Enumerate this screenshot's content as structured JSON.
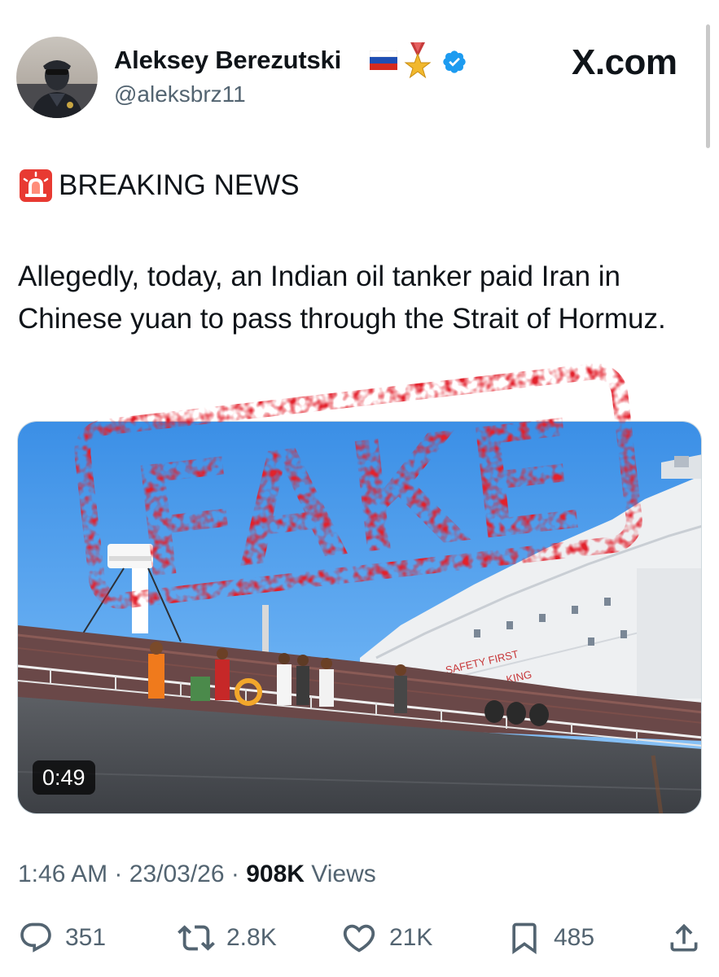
{
  "tweet": {
    "display_name": "Aleksey Berezutski",
    "handle": "@aleksbrz11",
    "source_label": "X.com",
    "headline": "BREAKING NEWS",
    "text": "Allegedly, today, an Indian oil tanker paid Iran in Chinese yuan to pass through the Strait of Hormuz.",
    "stamp_text": "FAKE",
    "media": {
      "duration": "0:49",
      "ship_sign": "SAFETY FIRST",
      "ship_sign_partial": "KING"
    },
    "meta": {
      "time": "1:46 AM",
      "date": "23/03/26",
      "separator": "·",
      "views_count": "908K",
      "views_label": "Views"
    },
    "actions": {
      "replies": "351",
      "reposts": "2.8K",
      "likes": "21K",
      "bookmarks": "485"
    }
  },
  "icons": {
    "flag": "russia-flag-icon",
    "medal": "gold-star-medal-icon",
    "verified": "verified-badge-icon",
    "siren": "siren-icon",
    "reply": "reply-icon",
    "repost": "repost-icon",
    "like": "heart-icon",
    "bookmark": "bookmark-icon",
    "share": "share-icon"
  },
  "colors": {
    "verified": "#1d9bf0",
    "stamp": "#e2202c",
    "text": "#0f1419",
    "secondary": "#536471"
  }
}
